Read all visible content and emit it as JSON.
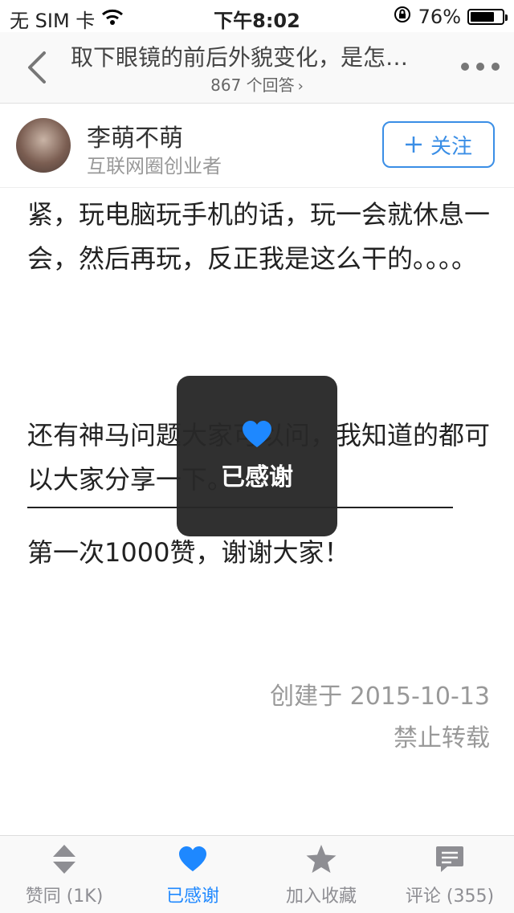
{
  "status_bar": {
    "carrier": "无 SIM 卡",
    "time": "下午8:02",
    "battery_percent": "76%",
    "battery_level": 0.76
  },
  "nav": {
    "title": "取下眼镜的前后外貌变化，是怎…",
    "answer_count": "867 个回答"
  },
  "author": {
    "name": "李萌不萌",
    "description": "互联网圈创业者",
    "follow_label": "关注"
  },
  "article": {
    "paragraph1": "紧，玩电脑玩手机的话，玩一会就休息一会，然后再玩，反正我是这么干的。。。。",
    "paragraph2": "还有神马问题大家可以问，我知道的都可以大家分享一下。",
    "paragraph3": "第一次1000赞，谢谢大家！",
    "created": "创建于 2015-10-13",
    "rights": "禁止转载"
  },
  "toast": {
    "text": "已感谢",
    "icon": "heart-icon"
  },
  "tab_bar": {
    "tabs": [
      {
        "label": "赞同 (1K)",
        "icon": "vote-arrows-icon"
      },
      {
        "label": "已感谢",
        "icon": "heart-icon"
      },
      {
        "label": "加入收藏",
        "icon": "star-icon"
      },
      {
        "label": "评论 (355)",
        "icon": "comment-icon"
      }
    ],
    "active_index": 1
  },
  "colors": {
    "accent": "#1E88FF",
    "follow_blue": "#3a8ee6",
    "inactive_icon": "#8e8e93",
    "toast_bg": "#282828"
  }
}
